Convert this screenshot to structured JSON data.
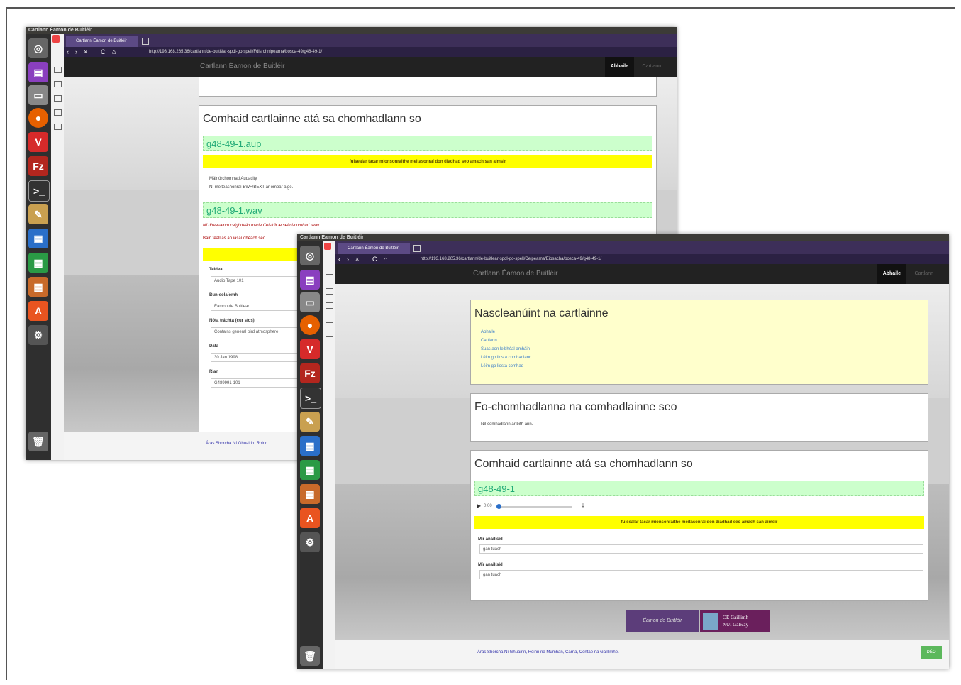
{
  "window_title": "Cartlann Éamon de Buitléir",
  "tab_title": "Cartlann Éamon de Buitléir",
  "back_window": {
    "url": "http://193.168.265.36/cartlann/de-buitléar-spdl-go-spell/Fdisrchnipearna/bosca-49/g48-49-1/",
    "site_brand": "Cartlann Éamon de Buitléir",
    "nav_active": "Abhaile",
    "nav_other": "Cartlann",
    "panel_title": "Comhaid cartlainne atá sa chomhadlann so",
    "file1": "g48-49-1.aup",
    "warning": "fuisealar tacar mionsonraithe meitasonraí don diadhad seo amach san aimsir",
    "meta_line1": "Málnórchomhad Audacity",
    "meta_line2": "Ní meiteashonraí BWF/BEXT ar ompar aige.",
    "file2": "g48-49-1.wav",
    "note_red": "Ní dheasainm caighdeán mede Ceisidir le seimi-comhad .wav",
    "note_link": "Bain féall as an iasaí dhéach seo.",
    "fields": [
      {
        "label": "Teideal",
        "value": "Audio Tape 101"
      },
      {
        "label": "Bun-eolaíomh",
        "value": "Éamon de Buitlear"
      },
      {
        "label": "Nóta tráchta (cur síos)",
        "value": "Contains general bird atmosphere"
      },
      {
        "label": "Dáta",
        "value": "30 Jan 1998"
      },
      {
        "label": "Rian",
        "value": "G489991-101"
      }
    ],
    "footer": "Áras Shorcha Ní Ghuairin, Roinn ..."
  },
  "front_window": {
    "url": "http://193.168.265.36/cartlann/de-buitlear-spdl-go-spell/Ceipearna/Eiosacha/bosca-49/g48-49-1/",
    "site_brand": "Cartlann Éamon de Buitléir",
    "nav_active": "Abhaile",
    "nav_other": "Cartlann",
    "nav_panel_title": "Nascleanúint na cartlainne",
    "nav_links": [
      "Abhaile",
      "Cartlann",
      "Suas aon leibhéal amháin",
      "Léim go liosta comhadlann",
      "Léim go liosta comhad"
    ],
    "sub_panel_title": "Fo-chomhadlanna na comhadlainne seo",
    "sub_panel_text": "Níl comhadlann ar bith ann.",
    "files_panel_title": "Comhaid cartlainne atá sa chomhadlann so",
    "file1": "g48-49-1",
    "player_time": "0:00",
    "warning": "fuisealar tacar mionsonraithe meitasonraí don diadhad seo amach san aimsir",
    "fields": [
      {
        "label": "Mír anailísid",
        "value": "gan tuach"
      },
      {
        "label": "Mír anailísid",
        "value": "gan tuach"
      }
    ],
    "logo_left": "Éamon de Buitléir",
    "logo_right_line1": "OÉ Gaillimh",
    "logo_right_line2": "NUI Galway",
    "footer": "Áras Shorcha Ní Ghuairin, Roinn na Mumhan, Carna, Contae na Gaillimhe.",
    "footer_button": "DÉO"
  },
  "colors": {
    "accent_purple": "#3d2f59",
    "warning_yellow": "#ffff00",
    "file_green": "#ccffcc",
    "nav_yellow": "#ffffcc"
  }
}
